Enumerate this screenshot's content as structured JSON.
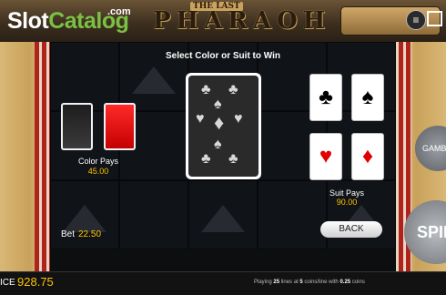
{
  "watermark": {
    "brand_slot": "Slot",
    "brand_catalog": "Catalog",
    "brand_com": ".com"
  },
  "header": {
    "title_the": "THE LAST",
    "title_main": "PHARAOH",
    "menu_icon": "hamburger-icon",
    "fullscreen_icon": "fullscreen-icon"
  },
  "gamble": {
    "heading": "Select Color or Suit to Win",
    "color_pays_label": "Color Pays",
    "color_pays_value": "45.00",
    "suit_pays_label": "Suit Pays",
    "suit_pays_value": "90.00",
    "back_label": "BACK",
    "bet_label": "Bet",
    "bet_value": "22.50",
    "suits": {
      "clubs": "♣",
      "spades": "♠",
      "hearts": "♥",
      "diamonds": "♦"
    }
  },
  "side_buttons": {
    "gamble": "GAMBLE",
    "spin": "SPIN"
  },
  "footer": {
    "balance_label": "ICE",
    "balance_value": "928.75",
    "status_prefix": "Playing",
    "lines": "25",
    "lines_text": "lines at",
    "coins": "5",
    "coins_text": "coins/line with",
    "coin_value": "0.25",
    "coins_suffix": "coins"
  },
  "colors": {
    "accent_gold": "#ffc400",
    "red_card": "#e00000"
  }
}
